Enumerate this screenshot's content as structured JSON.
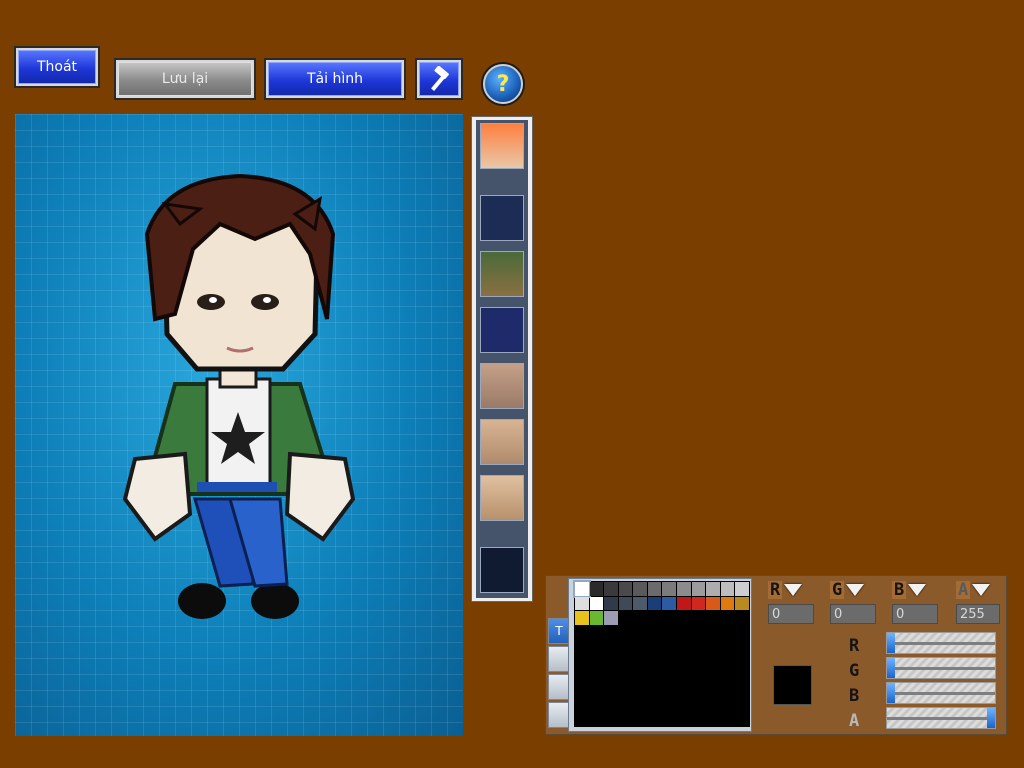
{
  "toolbar": {
    "exit_label": "Thoát",
    "save_label": "Lưu lại",
    "reload_label": "Tải hình",
    "help_glyph": "?"
  },
  "icons": {
    "hammer": "hammer-icon",
    "help": "help-icon"
  },
  "part_slots": [
    {
      "name": "hair-slot"
    },
    {
      "name": "empty-slot"
    },
    {
      "name": "hat-slot"
    },
    {
      "name": "outfit-slot"
    },
    {
      "name": "eyes-slot"
    },
    {
      "name": "mouth-slot"
    },
    {
      "name": "face-slot"
    },
    {
      "name": "empty-slot-2"
    }
  ],
  "palette": {
    "colors": [
      "#ffffff",
      "#2a2a2a",
      "#3a3a3a",
      "#4a4a4a",
      "#5a5a5a",
      "#6b6b6b",
      "#7b7b7b",
      "#8c8c8c",
      "#9c9c9c",
      "#adadad",
      "#bdbdbd",
      "#cecece",
      "#dedede",
      "#ffffff",
      "#2f3a4a",
      "#3e4a5a",
      "#4d5a6a",
      "#1a3f78",
      "#2d5aa0",
      "#c01818",
      "#d0281e",
      "#d85a18",
      "#e07a10",
      "#b88a20",
      "#e6c21a",
      "#68b830",
      "#9c9cb4"
    ],
    "tab_label": "T"
  },
  "channels": {
    "r": {
      "label": "R",
      "value": "0",
      "fraction": 0.0
    },
    "g": {
      "label": "G",
      "value": "0",
      "fraction": 0.0
    },
    "b": {
      "label": "B",
      "value": "0",
      "fraction": 0.0
    },
    "a": {
      "label": "A",
      "value": "255",
      "fraction": 1.0
    }
  },
  "colors": {
    "background": "#7a3e00",
    "selected_color": "#000000",
    "button_blue": "#1e37d8"
  }
}
